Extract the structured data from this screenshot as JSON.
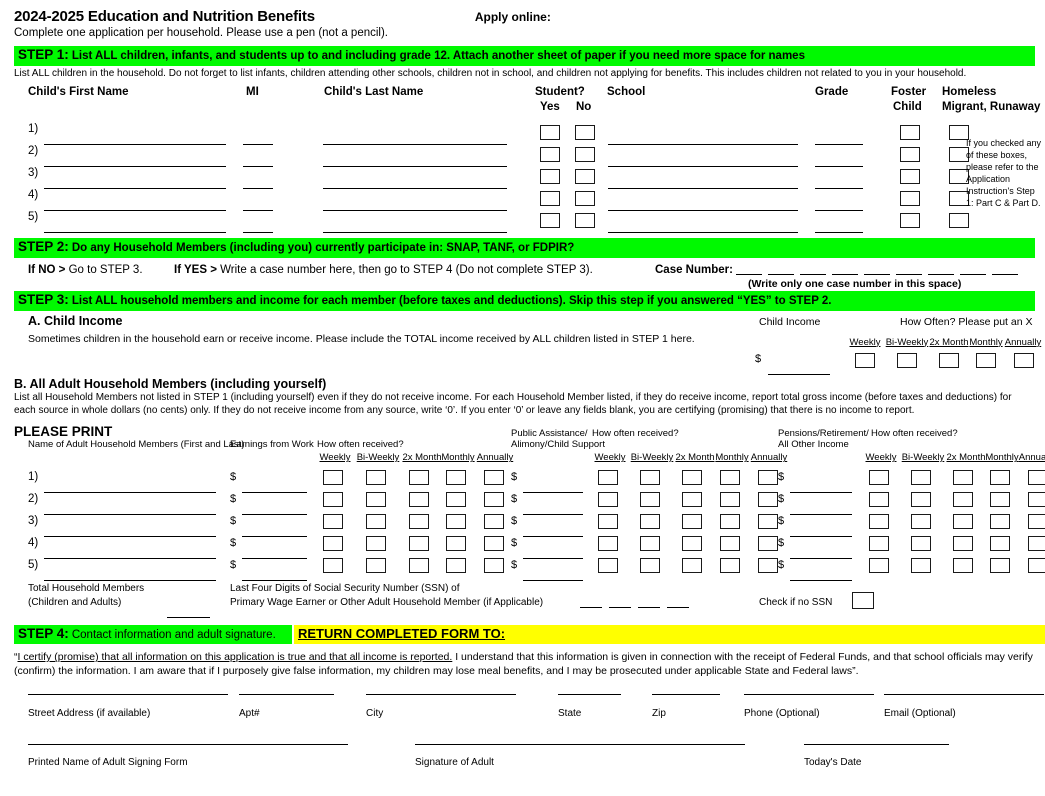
{
  "header": {
    "title": "2024-2025 Education and Nutrition Benefits",
    "apply_online": "Apply online:",
    "subtitle": "Complete one application per household. Please use a pen (not a pencil)."
  },
  "step1": {
    "number": "STEP 1:",
    "title": "List ALL children, infants, and students up to and including grade 12. Attach another sheet of paper if you need more space for names",
    "note": "List ALL children in the household. Do not forget to list infants, children attending other schools, children not in school, and children not applying for benefits. This includes children not related to you in your household.",
    "columns": {
      "first_name": "Child's First Name",
      "mi": "MI",
      "last_name": "Child's Last Name",
      "student": "Student?",
      "yes": "Yes",
      "no": "No",
      "school": "School",
      "grade": "Grade",
      "foster": "Foster",
      "foster2": "Child",
      "homeless": "Homeless",
      "homeless2": "Migrant, Runaway"
    },
    "row_numbers": [
      "1)",
      "2)",
      "3)",
      "4)",
      "5)"
    ],
    "side_note": "If you checked any of these boxes, please refer to the Application Instruction's Step 1: Part C & Part D."
  },
  "step2": {
    "number": "STEP 2:",
    "title": "Do any Household Members (including you) currently participate in:  SNAP, TANF, or FDPIR?",
    "if_no_bold": "If NO >",
    "if_no_rest": " Go to STEP 3.",
    "if_yes_bold": "If YES >",
    "if_yes_rest": " Write a case number here, then go to STEP 4 (Do not complete STEP 3).",
    "case_number_label": "Case Number:",
    "case_number_slots": 9,
    "case_note": "(Write only one case number in this space)"
  },
  "step3": {
    "number": "STEP 3:",
    "title": "List ALL household members and income for each member (before taxes and deductions). Skip this step if you answered “YES” to STEP 2.",
    "sectionA": {
      "heading": "A.  Child Income",
      "body": "Sometimes children in the household earn or receive income. Please include the TOTAL income received by ALL children listed in STEP 1 here.",
      "child_income_label": "Child Income",
      "how_often": "How Often?  Please put an X",
      "dollar": "$"
    },
    "sectionB": {
      "heading": "B.  All Adult Household Members (including yourself)",
      "body_line1": "List all Household Members not listed in STEP 1 (including yourself) even if they do not receive income. For each Household Member listed, if they do receive income, report total gross income (before taxes and deductions) for",
      "body_line2": "each source in whole dollars (no cents) only. If they do not receive income from any source, write ‘0’. If you enter ‘0’ or leave any fields blank, you are certifying (promising) that there is no income to report.",
      "please_print": "PLEASE PRINT",
      "name_col": "Name of Adult Household Members (First and Last)",
      "earnings_col": "Earnings from Work",
      "how_often": "How often received?",
      "pub_assist_1": "Public Assistance/",
      "pub_assist_2": "Alimony/Child Support",
      "pension_1": "Pensions/Retirement/",
      "pension_2": "All Other Income",
      "dollar": "$",
      "row_numbers": [
        "1)",
        "2)",
        "3)",
        "4)",
        "5)"
      ]
    },
    "frequencies": [
      "Weekly",
      "Bi-Weekly",
      "2x Month",
      "Monthly",
      "Annually"
    ],
    "totals": {
      "total_members_1": "Total Household Members",
      "total_members_2": "(Children and Adults)",
      "ssn_line1": "Last Four Digits of Social Security Number (SSN) of",
      "ssn_line2": "Primary Wage Earner or Other Adult Household Member (if Applicable)",
      "ssn_slots": 4,
      "check_no_ssn": "Check if no SSN"
    }
  },
  "step4": {
    "number": "STEP 4:",
    "title": "Contact information and adult signature.",
    "return_to": "RETURN COMPLETED FORM TO:",
    "certify_quote_open": "“",
    "certify_underlined": "I certify (promise) that all information on this application is true and that all income is reported.",
    "certify_rest": " I understand that this information is given in connection with the receipt of Federal Funds, and that school officials may verify (confirm) the information. I am aware that if I purposely give false information, my children may lose meal benefits, and I may be prosecuted under applicable State and Federal laws”.",
    "fields_row1": [
      "Street Address (if available)",
      "Apt#",
      "City",
      "State",
      "Zip",
      "Phone (Optional)",
      "Email (Optional)"
    ],
    "fields_row2": [
      "Printed Name of Adult Signing Form",
      "Signature of Adult",
      "Today's Date"
    ]
  },
  "colors": {
    "green": "#00f900",
    "yellow": "#ffff00",
    "ink": "#000000"
  }
}
